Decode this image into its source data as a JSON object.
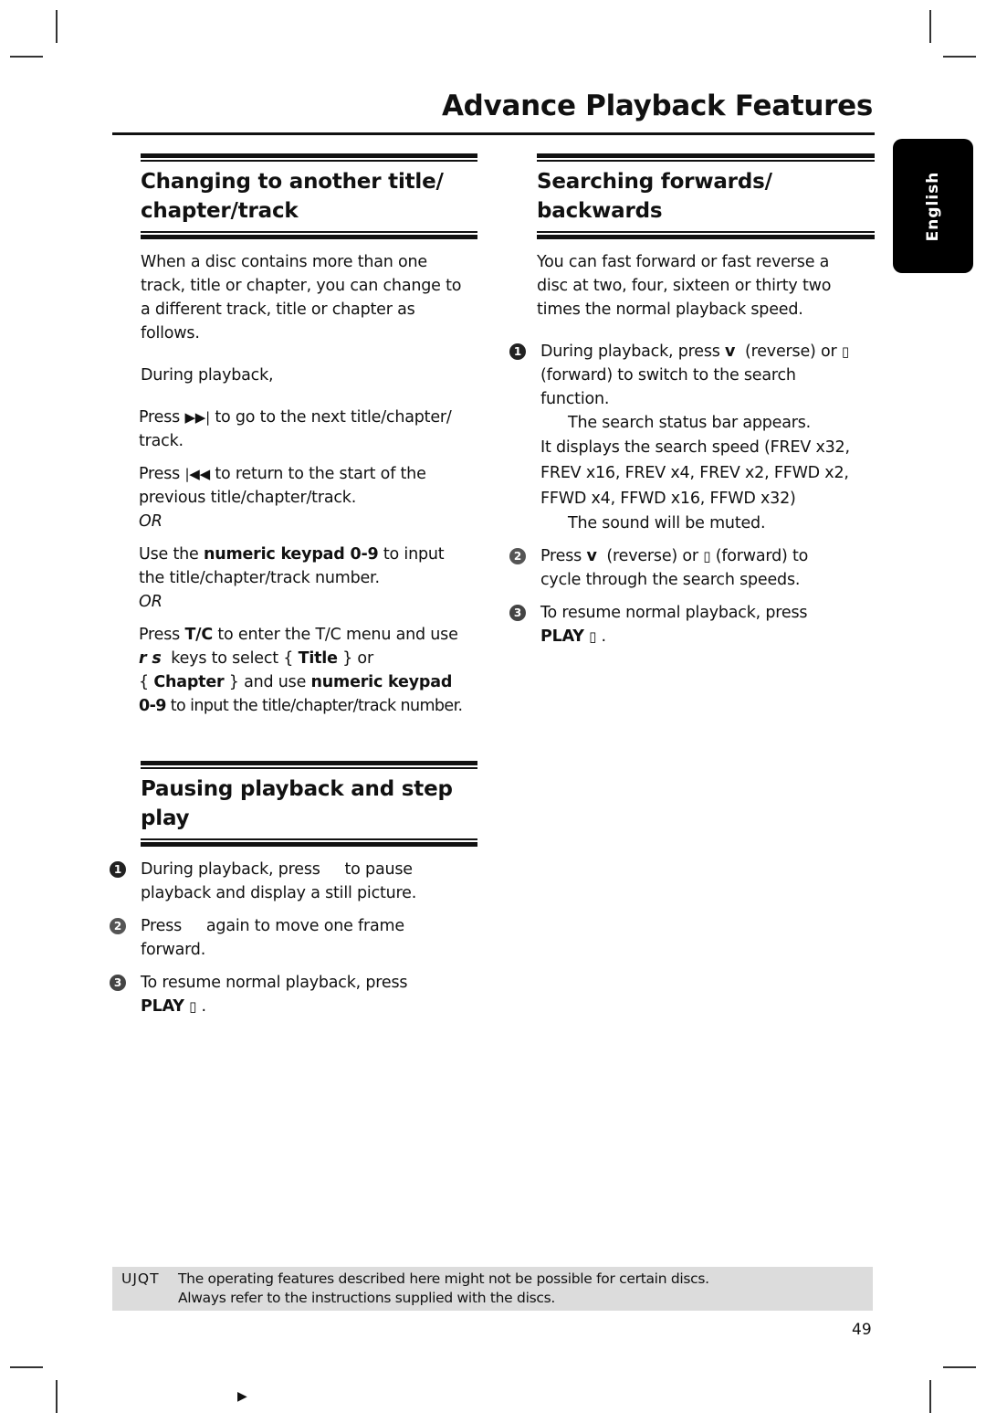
{
  "page": {
    "title": "Advance Playback Features",
    "language_tab": "English",
    "page_number": "49",
    "footer_marker_icon": "play-triangle-icon"
  },
  "sections": {
    "changing": {
      "title_line1": "Changing to another title/",
      "title_line2": "chapter/track",
      "intro": [
        "When a disc contains more than one",
        "track, title or chapter, you can change to",
        "a different track, title or chapter as",
        "follows."
      ],
      "during": "During playback,",
      "next": {
        "pre": "Press",
        "icon": "next-track-icon",
        "glyph": "▶▶|",
        "post": "to go to the next title/chapter/",
        "line2": "track."
      },
      "prev": {
        "pre": "Press",
        "icon": "previous-track-icon",
        "glyph": "|◀◀",
        "post": "to return to the start of the",
        "line2": "previous title/chapter/track."
      },
      "or1": "OR",
      "keypad": {
        "pre": "Use the",
        "bold": "numeric keypad 0-9",
        "post": "to input",
        "line2": "the title/chapter/track number."
      },
      "or2": "OR",
      "tc": {
        "l1_pre": "Press",
        "l1_bold": "T/C",
        "l1_post": "to enter the T/C menu and use",
        "l2_keys": "r  s",
        "l2_mid": "keys to select {",
        "l2_bold": "Title",
        "l2_post": "} or",
        "l3_pre": "{",
        "l3_bold1": "Chapter",
        "l3_mid": "} and use",
        "l3_bold2": "numeric keypad",
        "l4_bold": "0-9",
        "l4_post": "to input the title/chapter/track number."
      }
    },
    "searching": {
      "title_line1": "Searching forwards/",
      "title_line2": "backwards",
      "intro": [
        "You can fast forward or fast reverse a",
        "disc at two, four, sixteen or thirty two",
        "times the normal playback speed."
      ],
      "steps": [
        {
          "num": "1",
          "l1_pre": "During playback, press",
          "l1_key": "v",
          "l1_mid": "(reverse) or",
          "l1_glyph": "▯",
          "l2": "(forward) to switch to the search",
          "l3": "function.",
          "sub1": "The search status bar appears.",
          "sub2": [
            "It displays the search speed (FREV x32,",
            "FREV x16, FREV x4, FREV x2, FFWD x2,",
            "FFWD x4, FFWD x16, FFWD x32)"
          ],
          "sub3": "The sound will be muted."
        },
        {
          "num": "2",
          "l1_pre": "Press",
          "l1_key": "v",
          "l1_mid": "(reverse) or",
          "l1_glyph": "▯",
          "l1_post": "(forward) to",
          "l2": "cycle through the search speeds."
        },
        {
          "num": "3",
          "l1": "To resume normal playback, press",
          "l2_bold": "PLAY",
          "l2_glyph": "▯",
          "l2_post": "."
        }
      ]
    },
    "pausing": {
      "title_line1": "Pausing playback and step",
      "title_line2": "play",
      "steps": [
        {
          "num": "1",
          "l1_pre": "During playback, press",
          "l1_post": "to pause",
          "l2": "playback and display a still picture."
        },
        {
          "num": "2",
          "l1_pre": "Press",
          "l1_post": "again to move one frame",
          "l2": "forward."
        },
        {
          "num": "3",
          "l1": "To resume normal playback, press",
          "l2_bold": "PLAY",
          "l2_glyph": "▯",
          "l2_post": "."
        }
      ]
    }
  },
  "note": {
    "label": "UJQT",
    "lines": [
      "The operating features described here might not be possible for certain discs.",
      "Always refer to the instructions supplied with the discs."
    ]
  }
}
